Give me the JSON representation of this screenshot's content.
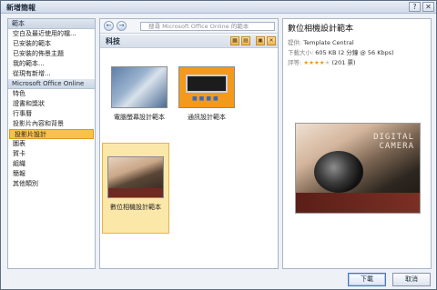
{
  "window": {
    "title": "新增簡報",
    "help_icon": "question-mark-icon",
    "close_icon": "close-icon"
  },
  "sidebar": {
    "sections": [
      {
        "heading": "範本",
        "items": [
          "空白及最近使用的檔...",
          "已安裝的範本",
          "已安裝的佈景主題",
          "我的範本...",
          "從現有新增..."
        ]
      },
      {
        "heading": "Microsoft Office Online",
        "items": [
          "特色",
          "證書和獎狀",
          "行事曆",
          "投影片內容和背景",
          "投影片設計",
          "圖表",
          "賀卡",
          "組織",
          "簡報",
          "其他類別"
        ]
      }
    ],
    "selected": "投影片設計"
  },
  "middle": {
    "nav": {
      "back": "←",
      "forward": "→",
      "search_placeholder": "搜尋 Microsoft Office Online 的範本",
      "search_arrow": "→"
    },
    "category": "科技",
    "view_buttons": [
      "▦",
      "▤",
      "▣",
      "✕"
    ],
    "templates": [
      {
        "caption": "電腦螢幕設計範本",
        "icon": "computer-screen-template-thumbnail"
      },
      {
        "caption": "通訊設計範本",
        "icon": "communication-template-thumbnail"
      },
      {
        "caption": "數位相機設計範本",
        "icon": "digital-camera-template-thumbnail"
      }
    ],
    "selected_template": "數位相機設計範本"
  },
  "details": {
    "name": "數位相機設計範本",
    "provider_label": "提供:",
    "provider": "Template Central",
    "size_label": "下載大小:",
    "size": "605 KB (2 分鐘 @ 56 Kbps)",
    "rating_label": "評等:",
    "rating_stars": 4,
    "rating_max": 5,
    "rating_count": "(201 票)",
    "preview_title_1": "DIGITAL",
    "preview_title_2": "CAMERA"
  },
  "footer": {
    "download": "下載",
    "cancel": "取消"
  }
}
